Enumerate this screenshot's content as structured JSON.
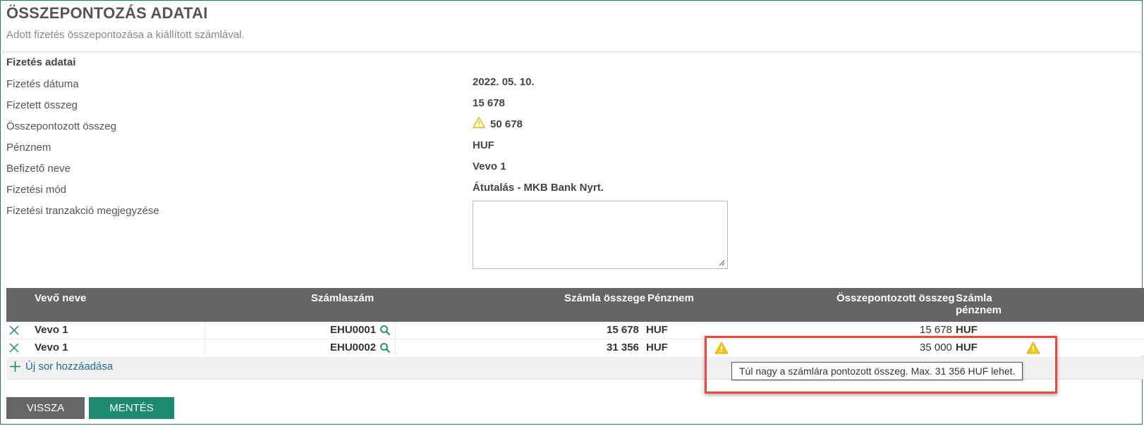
{
  "header": {
    "title": "ÖSSZEPONTOZÁS ADATAI",
    "subtitle": "Adott fizetés összepontozása a kiállított számlával."
  },
  "payment": {
    "section_title": "Fizetés adatai",
    "fields": {
      "date_label": "Fizetés dátuma",
      "date_value": "2022. 05. 10.",
      "paid_label": "Fizetett összeg",
      "paid_value": "15 678",
      "matched_label": "Összepontozott összeg",
      "matched_value": "50 678",
      "currency_label": "Pénznem",
      "currency_value": "HUF",
      "payer_label": "Befizető neve",
      "payer_value": "Vevo 1",
      "method_label": "Fizetési mód",
      "method_value": "Átutalás - MKB Bank Nyrt.",
      "note_label": "Fizetési tranzakció megjegyzése",
      "note_value": ""
    }
  },
  "table": {
    "columns": {
      "customer": "Vevő neve",
      "invoice_no": "Számlaszám",
      "invoice_amount": "Számla összege",
      "currency": "Pénznem",
      "matched_amount": "Összepontozott összeg",
      "invoice_currency_line1": "Számla",
      "invoice_currency_line2": "pénznem"
    },
    "rows": [
      {
        "customer": "Vevo 1",
        "invoice_no": "EHU0001",
        "invoice_amount": "15 678",
        "currency": "HUF",
        "matched_amount": "15 678",
        "invoice_currency": "HUF",
        "warning": false
      },
      {
        "customer": "Vevo 1",
        "invoice_no": "EHU0002",
        "invoice_amount": "31 356",
        "currency": "HUF",
        "matched_amount": "35 000",
        "invoice_currency": "HUF",
        "warning": true
      }
    ],
    "add_row_label": "Új sor hozzáadása"
  },
  "tooltip": {
    "text": "Túl nagy a számlára pontozott összeg. Max.  31 356 HUF lehet."
  },
  "buttons": {
    "back": "VISSZA",
    "save": "MENTÉS"
  },
  "colors": {
    "accent": "#1b8a6e",
    "header_bg": "#656565",
    "warning": "#f5c518",
    "highlight": "#e54b3c",
    "link": "#1a6f8f"
  },
  "icons": [
    "warning-icon",
    "close-icon",
    "search-icon",
    "plus-icon",
    "resize-handle-icon"
  ]
}
